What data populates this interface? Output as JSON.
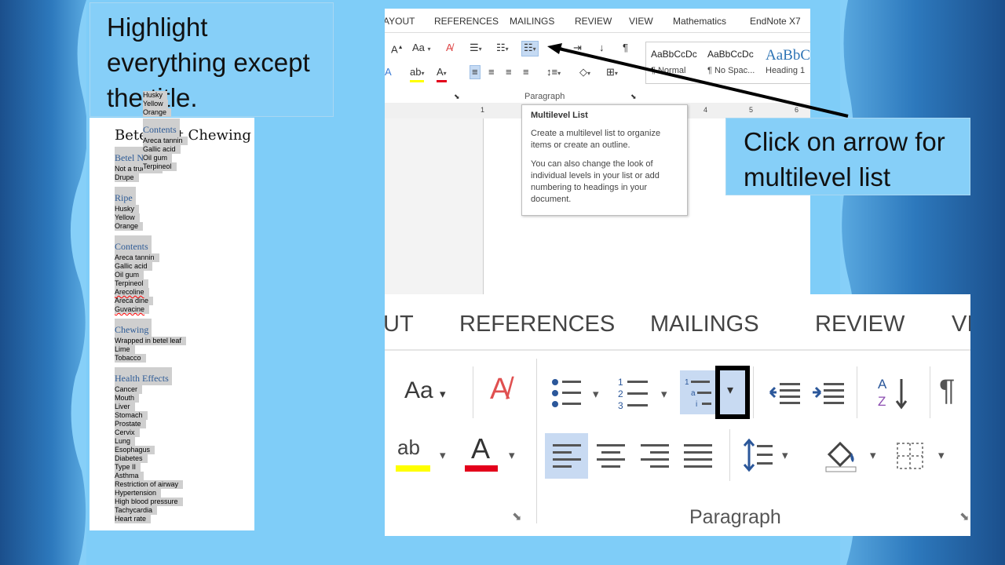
{
  "instructions": {
    "highlight": [
      "Highlight",
      "everything except",
      "the title."
    ],
    "click_arrow": [
      "Click on arrow for",
      "multilevel list"
    ]
  },
  "document": {
    "title": "Betel Nut Chewing",
    "sections": [
      {
        "heading": "Betel Nut",
        "items": [
          "Not a true nut",
          "Drupe"
        ]
      },
      {
        "heading": "Ripe",
        "items": [
          "Husky",
          "Yellow",
          "Orange"
        ]
      },
      {
        "heading": "Contents",
        "items": [
          "Areca tannin",
          "Gallic acid",
          "Oil gum",
          "Terpineol",
          "Arecoline",
          "Areca dine",
          "Guvacine"
        ]
      },
      {
        "heading": "Chewing",
        "items": [
          "Wrapped in betel leaf",
          "Lime",
          "Tobacco"
        ]
      },
      {
        "heading": "Health Effects",
        "items": [
          "Cancer",
          "Mouth",
          "Liver",
          "Stomach",
          "Prostate",
          "Cervix",
          "Lung",
          "Esophagus",
          "Diabetes",
          "Type II",
          "Asthma",
          "Restriction of airway",
          "Hypertension",
          "High blood pressure",
          "Tachycardia",
          "Heart rate"
        ]
      }
    ]
  },
  "ribbon": {
    "tabs": [
      "AYOUT",
      "REFERENCES",
      "MAILINGS",
      "REVIEW",
      "VIEW",
      "Mathematics",
      "EndNote X7"
    ],
    "paragraph_label": "Paragraph",
    "styles": [
      {
        "preview": "AaBbCcDc",
        "name": "¶ Normal"
      },
      {
        "preview": "AaBbCcDc",
        "name": "¶ No Spac..."
      },
      {
        "preview": "AaBbC",
        "name": "Heading 1"
      }
    ],
    "font_case_label": "Aa",
    "ruler_numbers": [
      "1",
      "4",
      "5",
      "6"
    ]
  },
  "preview_items": {
    "ripe": [
      "Husky",
      "Yellow",
      "Orange"
    ],
    "contents_heading": "Contents",
    "contents": [
      "Areca tannin",
      "Gallic acid",
      "Oil gum",
      "Terpineol"
    ]
  },
  "tooltip": {
    "title": "Multilevel List",
    "p1": "Create a multilevel list to organize items or create an outline.",
    "p2": "You can also change the look of individual levels in your list or add numbering to headings in your document."
  },
  "zoom": {
    "tabs": [
      "UT",
      "REFERENCES",
      "MAILINGS",
      "REVIEW",
      "VI"
    ],
    "paragraph_label": "Paragraph",
    "font_case_label": "Aa",
    "highlight_color": "#ffff00",
    "font_color": "#e3001b"
  },
  "colors": {
    "background": "#7fcdf8",
    "heading_blue": "#2e5b96",
    "selection_gray": "#cfcfcf",
    "callout_box": "#000000"
  }
}
